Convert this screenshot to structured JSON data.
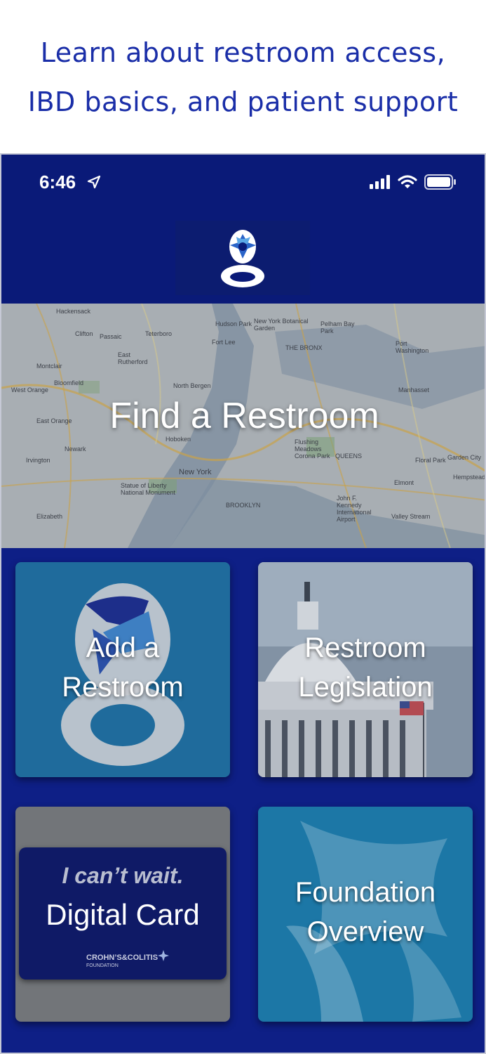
{
  "headline": {
    "line1": "Learn about restroom access,",
    "line2": "IBD basics, and patient support"
  },
  "status_bar": {
    "time": "6:46",
    "icons": [
      "location-arrow-icon",
      "signal-icon",
      "wifi-icon",
      "battery-icon"
    ]
  },
  "app": {
    "logo_icon": "toilet-logo-icon"
  },
  "map": {
    "title": "Find a Restroom",
    "labels": [
      "Hackensack",
      "Hudson Park",
      "New York Botanical Garden",
      "Pelham Bay Park",
      "Clifton",
      "Passaic",
      "Teterboro",
      "Fort Lee",
      "THE BRONX",
      "Port Washington",
      "Montclair",
      "East Rutherford",
      "Bloomfield",
      "North Bergen",
      "Manhasset",
      "West Orange",
      "East Orange",
      "Flushing Meadows Corona Park",
      "QUEENS",
      "Newark",
      "Hoboken",
      "New York",
      "Irvington",
      "Statue of Liberty National Monument",
      "BROOKLYN",
      "John F. Kennedy International Airport",
      "Elizabeth",
      "Elmont",
      "Hempstead",
      "Valley Stream",
      "Floral Park",
      "Garden City"
    ]
  },
  "tiles": [
    {
      "label_line1": "Add a",
      "label_line2": "Restroom"
    },
    {
      "label_line1": "Restroom",
      "label_line2": "Legislation"
    },
    {
      "label_line1": "",
      "label_line2": ""
    },
    {
      "label_line1": "Foundation",
      "label_line2": "Overview"
    }
  ],
  "digital_card": {
    "tagline": "I can’t wait.",
    "title": "Digital Card",
    "org_name": "CROHN’S&COLITIS",
    "org_sub": "FOUNDATION"
  },
  "colors": {
    "brand_navy": "#0e1f86",
    "headline_blue": "#1a2ea8",
    "tile_teal": "#1c77a6"
  }
}
